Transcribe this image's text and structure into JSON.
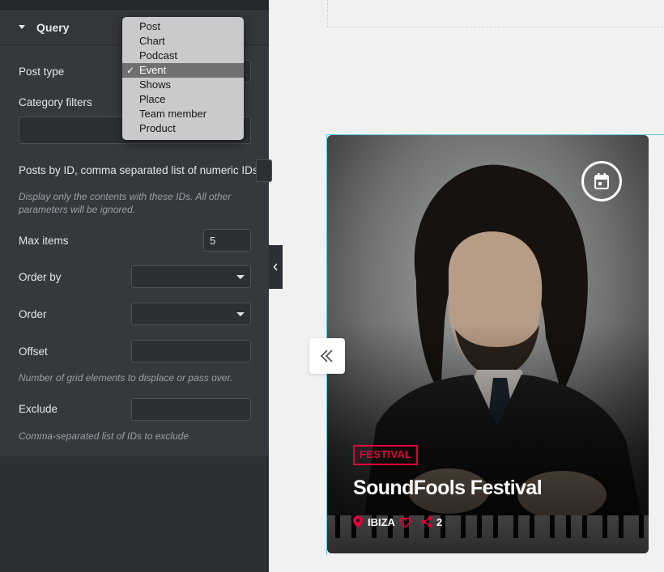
{
  "panel": {
    "section_title": "Query",
    "post_type_label": "Post type",
    "category_filters_label": "Category filters",
    "posts_by_id_label": "Posts by ID, comma separated list of numeric IDs",
    "posts_by_id_hint": "Display only the contents with these IDs. All other parameters will be ignored.",
    "max_items_label": "Max items",
    "max_items_value": "5",
    "order_by_label": "Order by",
    "order_label": "Order",
    "offset_label": "Offset",
    "offset_hint": "Number of grid elements to displace or pass over.",
    "exclude_label": "Exclude",
    "exclude_hint": "Comma-separated list of IDs to exclude"
  },
  "post_type_dropdown": {
    "selected": "Event",
    "check_mark": "✓",
    "options": [
      "Post",
      "Chart",
      "Podcast",
      "Event",
      "Shows",
      "Place",
      "Team member",
      "Product"
    ]
  },
  "card": {
    "tag": "FESTIVAL",
    "title": "SoundFools Festival",
    "location": "IBIZA",
    "share_count": "2",
    "icons": [
      "calendar-icon",
      "location-pin-icon",
      "heart-icon",
      "share-icon"
    ],
    "accent_color": "#e4003a"
  },
  "icons": {
    "section_caret": "caret-down-icon",
    "collapse": "chevron-left-icon",
    "carousel_prev": "double-chevron-left-icon"
  }
}
